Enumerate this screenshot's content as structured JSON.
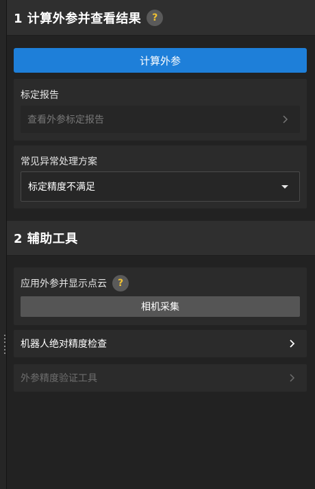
{
  "section1": {
    "title": "1 计算外参并查看结果",
    "help_icon": "question-mark-icon",
    "compute_button": "计算外参",
    "report_card": {
      "label": "标定报告",
      "link_text": "查看外参标定报告"
    },
    "faq_card": {
      "label": "常见异常处理方案",
      "selected": "标定精度不满足"
    }
  },
  "section2": {
    "title": "2 辅助工具",
    "pointcloud_card": {
      "label": "应用外参并显示点云",
      "capture_button": "相机采集"
    },
    "robot_check": "机器人绝对精度检查",
    "verify_tool": "外参精度验证工具"
  },
  "colors": {
    "accent": "#1e7fd9",
    "help_glyph": "#f1c232"
  }
}
